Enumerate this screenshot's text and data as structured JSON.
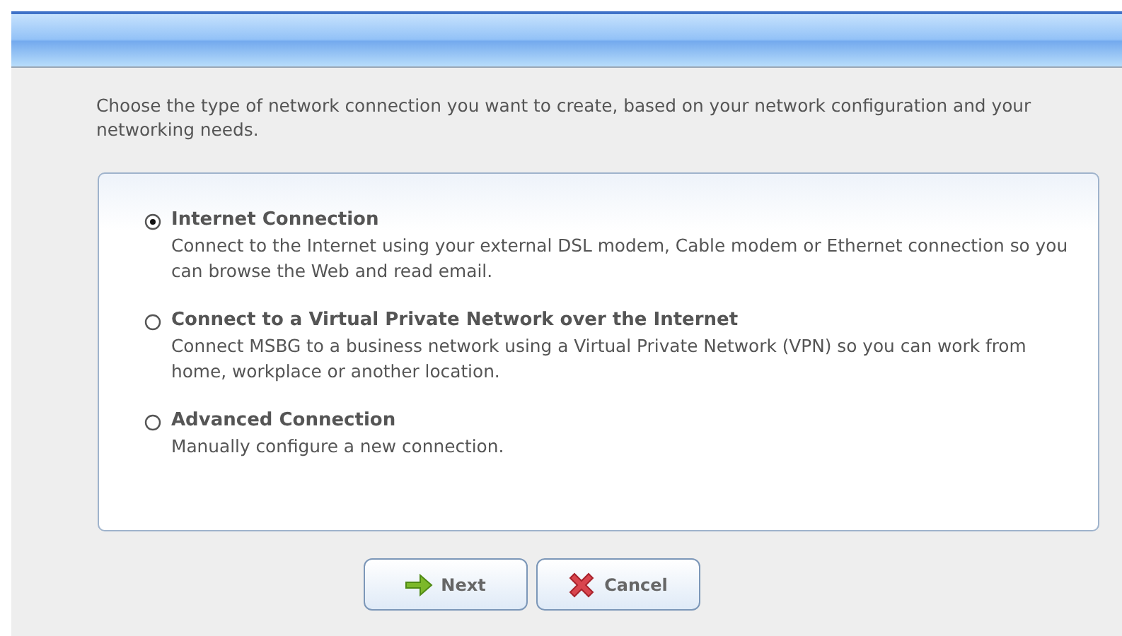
{
  "intro": "Choose the type of network connection you want to create, based on your network configuration and your networking needs.",
  "options": [
    {
      "title": "Internet Connection",
      "description": "Connect to the Internet using your external DSL modem, Cable modem or Ethernet connection so you can browse the Web and read email.",
      "selected": true
    },
    {
      "title": "Connect to a Virtual Private Network over the Internet",
      "description": "Connect MSBG to a business network using a Virtual Private Network (VPN) so you can work from home, workplace or another location.",
      "selected": false
    },
    {
      "title": "Advanced Connection",
      "description": "Manually configure a new connection.",
      "selected": false
    }
  ],
  "buttons": [
    {
      "kind": "next",
      "label": "Next"
    },
    {
      "kind": "cancel",
      "label": "Cancel"
    }
  ]
}
